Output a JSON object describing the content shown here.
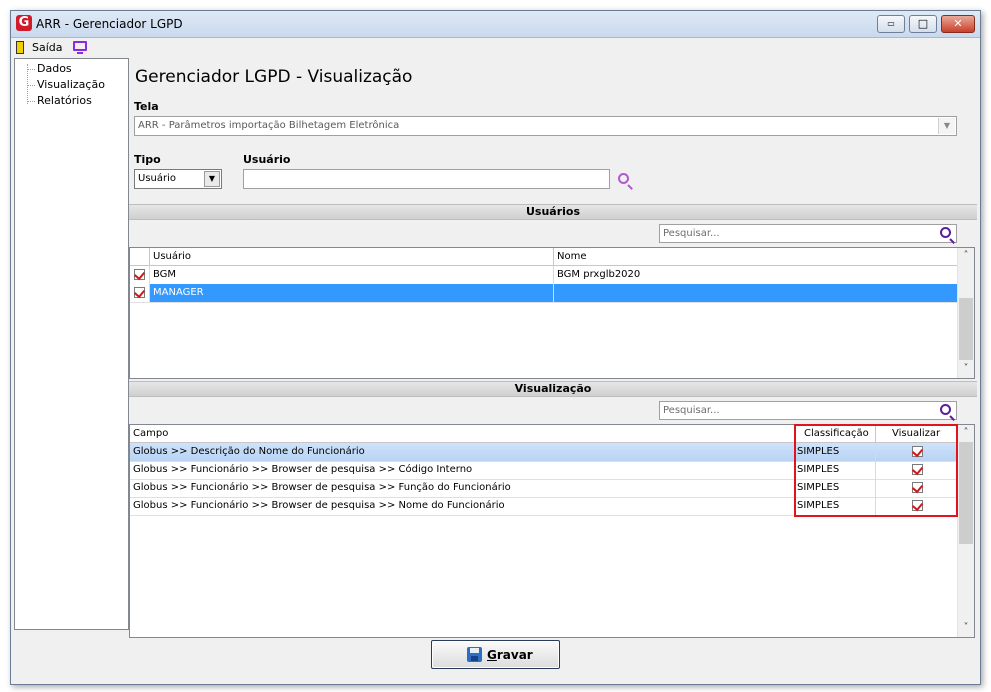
{
  "window": {
    "title": "ARR - Gerenciador LGPD",
    "logo_letter": "G",
    "controls": {
      "minimize": "▭",
      "maximize": "□",
      "close": "✕"
    }
  },
  "menu": {
    "exit_label": "Saída"
  },
  "tree": {
    "items": [
      "Dados",
      "Visualização",
      "Relatórios"
    ]
  },
  "page": {
    "title": "Gerenciador LGPD - Visualização"
  },
  "form": {
    "tela_label": "Tela",
    "tela_value": "ARR - Parâmetros importação Bilhetagem Eletrônica",
    "tipo_label": "Tipo",
    "tipo_value": "Usuário",
    "usuario_label": "Usuário",
    "usuario_value": ""
  },
  "usuarios": {
    "section_title": "Usuários",
    "search_placeholder": "Pesquisar...",
    "columns": [
      "Usuário",
      "Nome"
    ],
    "rows": [
      {
        "checked": true,
        "usuario": "BGM",
        "nome": "BGM prxglb2020",
        "selected": false
      },
      {
        "checked": true,
        "usuario": "MANAGER",
        "nome": "",
        "selected": true
      }
    ]
  },
  "visualizacao": {
    "section_title": "Visualização",
    "search_placeholder": "Pesquisar...",
    "columns": [
      "Campo",
      "Classificação",
      "Visualizar"
    ],
    "rows": [
      {
        "campo": "Globus >> Descrição do Nome do Funcionário",
        "classificacao": "SIMPLES",
        "visualizar": true,
        "selected": true
      },
      {
        "campo": "Globus >> Funcionário >> Browser de pesquisa >> Código Interno",
        "classificacao": "SIMPLES",
        "visualizar": true,
        "selected": false
      },
      {
        "campo": "Globus >> Funcionário >> Browser de pesquisa >> Função do Funcionário",
        "classificacao": "SIMPLES",
        "visualizar": true,
        "selected": false
      },
      {
        "campo": "Globus >> Funcionário >> Browser de pesquisa >> Nome do Funcionário",
        "classificacao": "SIMPLES",
        "visualizar": true,
        "selected": false
      }
    ]
  },
  "actions": {
    "save_label_first": "G",
    "save_label_rest": "ravar"
  },
  "colors": {
    "accent_red": "#e0141e",
    "selection_blue": "#3399ff",
    "search_purple": "#5a1f9a"
  }
}
